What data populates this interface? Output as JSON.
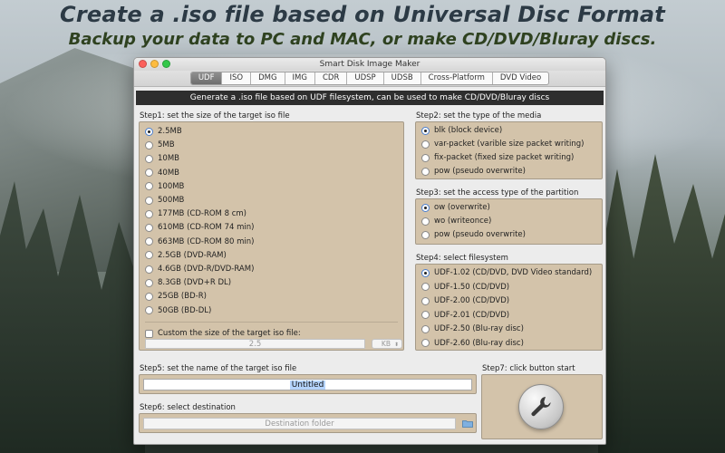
{
  "headline": {
    "title": "Create a .iso file based on Universal Disc Format",
    "subtitle": "Backup your data to PC and MAC, or make CD/DVD/Bluray discs."
  },
  "window": {
    "title": "Smart Disk Image Maker",
    "tabs": [
      "UDF",
      "ISO",
      "DMG",
      "IMG",
      "CDR",
      "UDSP",
      "UDSB",
      "Cross-Platform",
      "DVD Video"
    ],
    "active_tab": "UDF",
    "banner": "Generate a .iso file based on UDF filesystem, can be used to make CD/DVD/Bluray discs"
  },
  "step1": {
    "label": "Step1: set the size of the target iso file",
    "options": [
      "2.5MB",
      "5MB",
      "10MB",
      "40MB",
      "100MB",
      "500MB",
      "177MB (CD-ROM 8 cm)",
      "610MB (CD-ROM 74 min)",
      "663MB (CD-ROM 80 min)",
      "2.5GB (DVD-RAM)",
      "4.6GB (DVD-R/DVD-RAM)",
      "8.3GB (DVD+R DL)",
      "25GB (BD-R)",
      "50GB (BD-DL)"
    ],
    "selected": "2.5MB",
    "custom_label": "Custom the size of the target iso file:",
    "custom_value": "2.5",
    "unit": "KB"
  },
  "step2": {
    "label": "Step2: set the type of the media",
    "options": [
      "blk (block device)",
      "var-packet (varible size packet writing)",
      "fix-packet (fixed size packet writing)",
      "pow (pseudo overwrite)"
    ],
    "selected": "blk (block device)"
  },
  "step3": {
    "label": "Step3: set the access type of the partition",
    "options": [
      "ow (overwrite)",
      "wo (writeonce)",
      "pow (pseudo overwrite)"
    ],
    "selected": "ow (overwrite)"
  },
  "step4": {
    "label": "Step4: select filesystem",
    "options": [
      "UDF-1.02 (CD/DVD, DVD Video standard)",
      "UDF-1.50 (CD/DVD)",
      "UDF-2.00 (CD/DVD)",
      "UDF-2.01 (CD/DVD)",
      "UDF-2.50 (Blu-ray disc)",
      "UDF-2.60 (Blu-ray disc)"
    ],
    "selected": "UDF-1.02 (CD/DVD, DVD Video standard)"
  },
  "step5": {
    "label": "Step5: set the name of the target iso file",
    "value": "Untitled"
  },
  "step6": {
    "label": "Step6: select destination",
    "placeholder": "Destination folder"
  },
  "step7": {
    "label": "Step7: click button start"
  },
  "icons": {
    "start": "wrench-icon",
    "folder": "folder-icon"
  },
  "colors": {
    "panel": "#d3c3aa",
    "banner": "#2e2e2e",
    "active_tab": "#7a7a7a"
  }
}
